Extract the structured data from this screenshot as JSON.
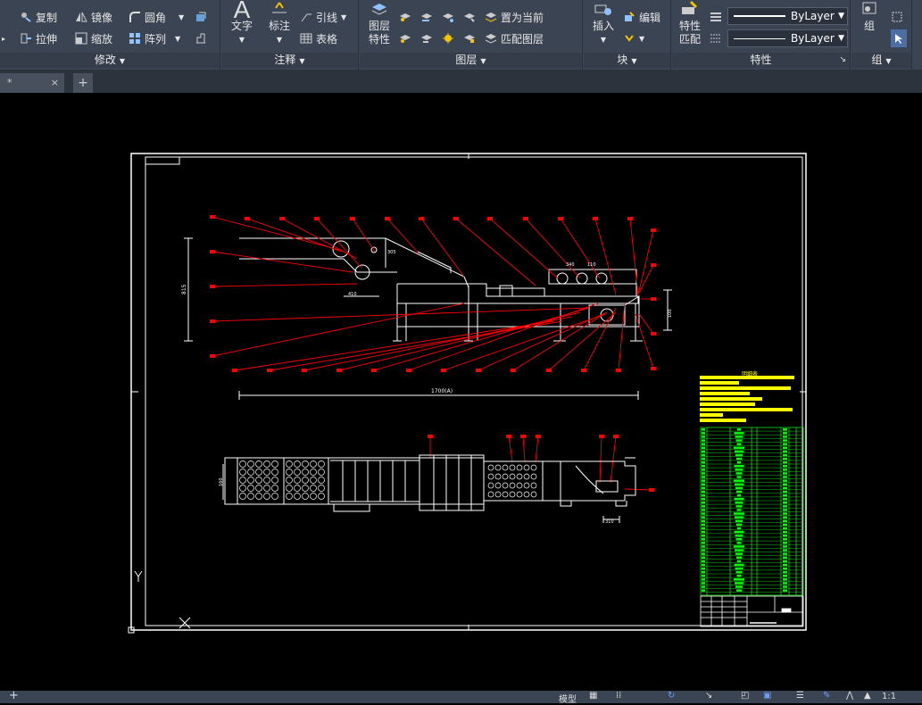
{
  "ribbon": {
    "modify": {
      "title": "修改",
      "copy": "复制",
      "mirror": "镜像",
      "fillet": "圆角",
      "stretch": "拉伸",
      "scale": "缩放",
      "array": "阵列"
    },
    "annotation": {
      "title": "注释",
      "text": "文字",
      "dimension": "标注",
      "leader": "引线",
      "table": "表格"
    },
    "layers": {
      "title": "图层",
      "layer_properties": "图层\n特性",
      "set_current": "置为当前",
      "match_layer": "匹配图层"
    },
    "block": {
      "title": "块",
      "insert": "插入",
      "edit": "编辑"
    },
    "properties": {
      "title": "特性",
      "match": "特性\n匹配",
      "linetype": "ByLayer",
      "lineweight": "ByLayer"
    },
    "groups": {
      "title": "组",
      "group": "组"
    }
  },
  "tabs": {
    "drawing_tab": "*",
    "close": "×",
    "new": "+"
  },
  "drawing": {
    "bom_title": "明细表",
    "dim_total": "1700(A)",
    "dim_height": "815",
    "dim_a": "410",
    "dim_b": "305",
    "dim_c": "160",
    "dim_d": "100",
    "dim_e": "340",
    "dim_f": "110",
    "dim_g": "310"
  },
  "statusbar": {
    "model": "模型",
    "scale": "1:1"
  },
  "colors": {
    "ribbon_bg": "#3b4453",
    "canvas_bg": "#000000",
    "drawing_lines": "#ffffff",
    "leaders": "#ff0000",
    "bom_fill": "#ffff00",
    "table_lines": "#00ff00"
  }
}
